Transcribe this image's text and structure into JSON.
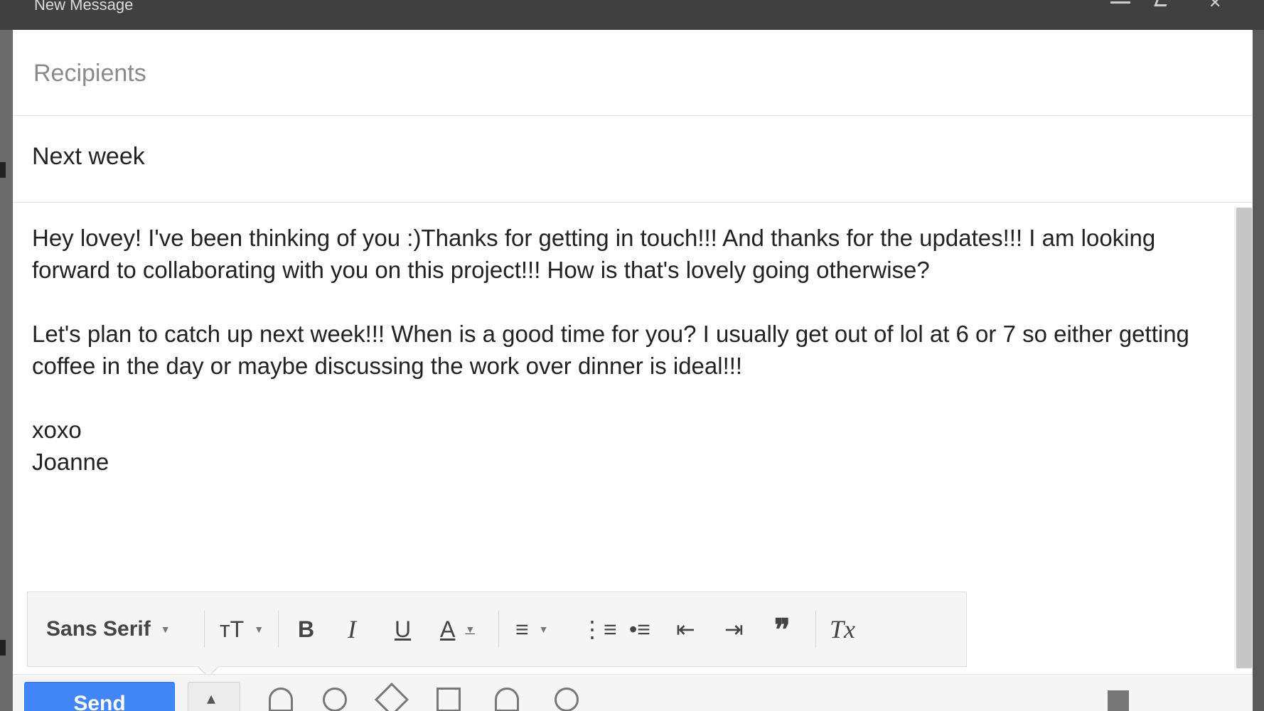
{
  "window": {
    "title": "New Message",
    "icons": [
      "minimize-icon",
      "maximize-icon",
      "close-icon"
    ]
  },
  "compose": {
    "recipients_placeholder": "Recipients",
    "subject": "Next week",
    "body": {
      "paragraph_1": "Hey lovey! I've been thinking of you :)Thanks for getting in touch!!! And thanks for the updates!!! I am looking forward to collaborating with you on this project!!! How is that's lovely going otherwise?",
      "paragraph_2": "Let's plan to catch up next week!!! When is a good time for you? I usually get out of lol at 6 or 7 so either getting coffee in the day or maybe discussing the work over dinner is ideal!!!",
      "signoff": "xoxo",
      "signature": "Joanne"
    }
  },
  "toolbar": {
    "font": "Sans Serif",
    "size_glyph": "ᴛT",
    "bold_glyph": "B",
    "italic_glyph": "I",
    "underline_glyph": "U",
    "text_color_glyph": "A",
    "align_glyph": "≡",
    "numbered_list_glyph": "⋮≡",
    "bulleted_list_glyph": "•≡",
    "indent_less_glyph": "⇤",
    "indent_more_glyph": "⇥",
    "quote_glyph": "❞",
    "remove_format_glyph": "Tx"
  },
  "actionbar": {
    "send_label": "Send",
    "more_glyph": "▴"
  }
}
